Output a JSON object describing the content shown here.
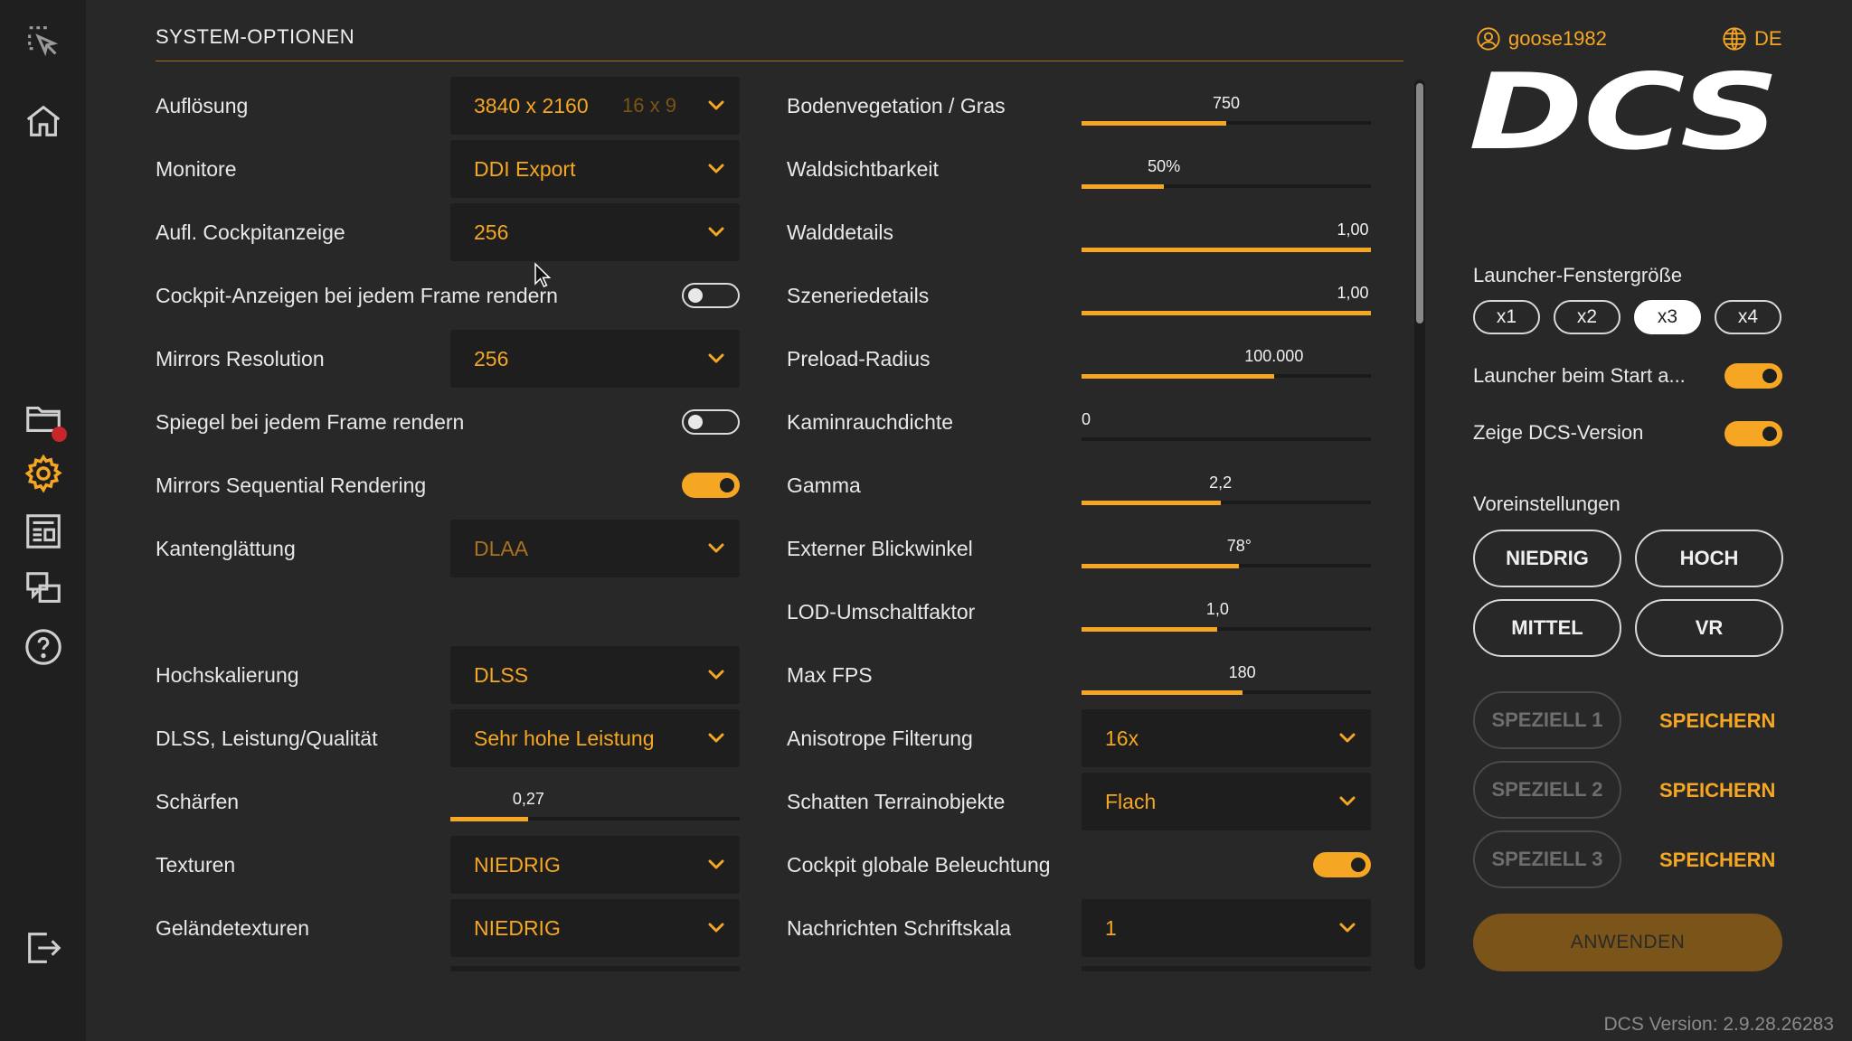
{
  "page": {
    "section_title": "SYSTEM-OPTIONEN"
  },
  "theme": {
    "accent": "#f5a623",
    "background": "#282828",
    "sidebar": "#1f1f1f",
    "notification": "#c8262b"
  },
  "sidebar": {
    "icons": [
      "select-icon",
      "home-icon",
      "folder-icon",
      "settings-icon",
      "news-icon",
      "chat-icon",
      "help-icon",
      "logout-icon"
    ]
  },
  "left": {
    "rows": [
      {
        "label": "Auflösung",
        "type": "dropdown",
        "value": "3840 x 2160",
        "extra": "16 x 9"
      },
      {
        "label": "Monitore",
        "type": "dropdown",
        "value": "DDI Export"
      },
      {
        "label": "Aufl. Cockpitanzeige",
        "type": "dropdown",
        "value": "256"
      },
      {
        "label": "Cockpit-Anzeigen bei jedem Frame rendern",
        "type": "toggle",
        "on": false
      },
      {
        "label": "Mirrors Resolution",
        "type": "dropdown",
        "value": "256"
      },
      {
        "label": "Spiegel bei jedem Frame rendern",
        "type": "toggle",
        "on": false
      },
      {
        "label": "Mirrors Sequential Rendering",
        "type": "toggle",
        "on": true
      },
      {
        "label": "Kantenglättung",
        "type": "dropdown",
        "value": "DLAA",
        "muted": true
      },
      {
        "label": "Hochskalierung",
        "type": "dropdown",
        "value": "DLSS"
      },
      {
        "label": "DLSS, Leistung/Qualität",
        "type": "dropdown",
        "value": "Sehr hohe Leistung"
      },
      {
        "label": "Schärfen",
        "type": "slider",
        "value": "0,27",
        "fraction": 0.27
      },
      {
        "label": "Texturen",
        "type": "dropdown",
        "value": "NIEDRIG"
      },
      {
        "label": "Geländetexturen",
        "type": "dropdown",
        "value": "NIEDRIG"
      }
    ]
  },
  "middle": {
    "rows": [
      {
        "label": "Bodenvegetation / Gras",
        "type": "slider",
        "value": "750",
        "fraction": 0.5
      },
      {
        "label": "Waldsichtbarkeit",
        "type": "slider",
        "value": "50%",
        "fraction": 0.285
      },
      {
        "label": "Walddetails",
        "type": "slider",
        "value": "1,00",
        "fraction": 1.0
      },
      {
        "label": "Szeneriedetails",
        "type": "slider",
        "value": "1,00",
        "fraction": 1.0
      },
      {
        "label": "Preload-Radius",
        "type": "slider",
        "value": "100.000",
        "fraction": 0.665
      },
      {
        "label": "Kaminrauchdichte",
        "type": "slider",
        "value": "0",
        "fraction": 0.0
      },
      {
        "label": "Gamma",
        "type": "slider",
        "value": "2,2",
        "fraction": 0.48
      },
      {
        "label": "Externer Blickwinkel",
        "type": "slider",
        "value": "78°",
        "fraction": 0.545
      },
      {
        "label": "LOD-Umschaltfaktor",
        "type": "slider",
        "value": "1,0",
        "fraction": 0.47
      },
      {
        "label": "Max FPS",
        "type": "slider",
        "value": "180",
        "fraction": 0.555
      },
      {
        "label": "Anisotrope Filterung",
        "type": "dropdown",
        "value": "16x"
      },
      {
        "label": "Schatten Terrainobjekte",
        "type": "dropdown",
        "value": "Flach"
      },
      {
        "label": "Cockpit globale Beleuchtung",
        "type": "toggle",
        "on": true
      },
      {
        "label": "Nachrichten Schriftskala",
        "type": "dropdown",
        "value": "1"
      }
    ]
  },
  "right": {
    "username": "goose1982",
    "language": "DE",
    "logo_text": "DCS",
    "window_size_label": "Launcher-Fenstergröße",
    "window_sizes": [
      "x1",
      "x2",
      "x3",
      "x4"
    ],
    "window_size_selected": "x3",
    "launcher_start_label": "Launcher beim Start a...",
    "launcher_start_on": true,
    "show_version_label": "Zeige DCS-Version",
    "show_version_on": true,
    "presets_label": "Voreinstellungen",
    "presets": [
      "NIEDRIG",
      "HOCH",
      "MITTEL",
      "VR"
    ],
    "specials": [
      "SPEZIELL 1",
      "SPEZIELL 2",
      "SPEZIELL 3"
    ],
    "save_label": "SPEICHERN",
    "apply_label": "ANWENDEN"
  },
  "footer": {
    "version": "DCS Version: 2.9.28.26283"
  }
}
